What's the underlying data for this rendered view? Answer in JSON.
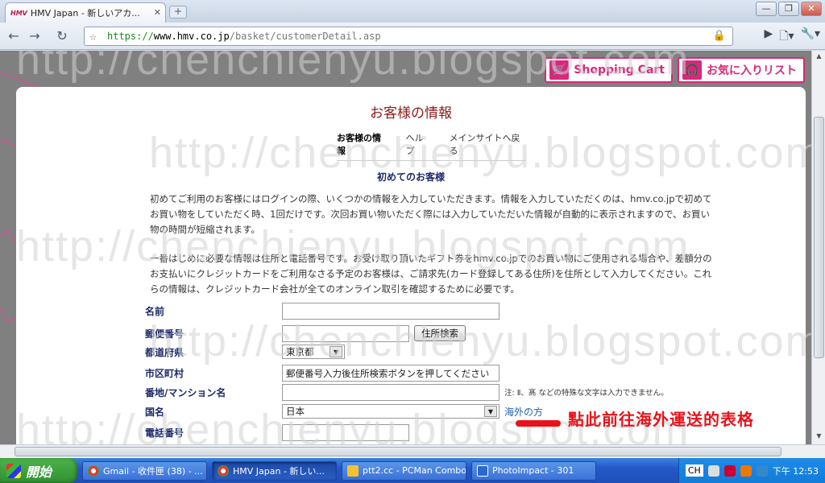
{
  "browser": {
    "tab_title": "HMV Japan - 新しいアカ...",
    "tab_favicon_text": "HMV",
    "url_scheme": "https://",
    "url_host": "www.hmv.co.jp",
    "url_path": "/basket/customerDetail.asp"
  },
  "header_buttons": {
    "cart": "Shopping Cart",
    "wishlist": "お気に入りリスト"
  },
  "page": {
    "title": "お客様の情報",
    "subnav": [
      "お客様の情報",
      "ヘルプ",
      "メインサイトへ戻る"
    ],
    "section_title": "初めてのお客様",
    "para1": "初めてご利用のお客様にはログインの際、いくつかの情報を入力していただきます。情報を入力していただくのは、hmv.co.jpで初めてお買い物をしていただく時、1回だけです。次回お買い物いただく際には入力していただいた情報が自動的に表示されますので、お買い物の時間が短縮されます。",
    "para2": "一番はじめに必要な情報は住所と電話番号です。お受け取り頂いたギフト券をhmv.co.jpでのお買い物にご使用される場合や、差額分のお支払いにクレジットカードをご利用なさる予定のお客様は、ご請求先(カード登録してある住所)を住所として入力してください。これらの情報は、クレジットカード会社が全てのオンライン取引を確認するために必要です。"
  },
  "form": {
    "name_label": "名前",
    "name_value": "",
    "postal_label": "郵便番号",
    "postal_value": "",
    "address_search_button": "住所検索",
    "prefecture_label": "都道府県",
    "prefecture_value": "東京都",
    "city_label": "市区町村",
    "city_value": "郵便番号入力後住所検索ボタンを押してください",
    "street_label": "番地/マンション名",
    "street_value": "",
    "street_note": "注: Ⅱ、髙 などの特殊な文字は入力できません。",
    "country_label": "国名",
    "country_value": "日本",
    "overseas_link": "海外の方",
    "phone_label": "電話番号",
    "phone_value": ""
  },
  "annotation": "點此前往海外運送的表格",
  "watermark": "http://chenchienyu.blogspot.com",
  "taskbar": {
    "start": "開始",
    "tasks": [
      "Gmail - 收件匣 (38) - ...",
      "HMV Japan - 新しい...",
      "ptt2.cc - PCMan Combo",
      "PhotoImpact - 301"
    ],
    "ime": "CH",
    "clock": "下午 12:53"
  },
  "colors": {
    "brand_pink": "#d7287a",
    "title_red": "#8c1a1a",
    "label_navy": "#1c2a6a",
    "annotation_red": "#e8131a"
  }
}
